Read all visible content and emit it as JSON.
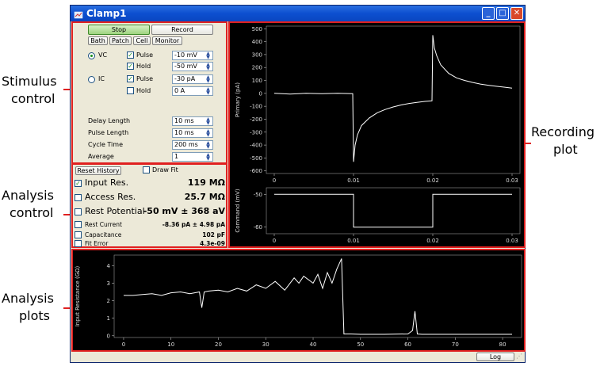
{
  "window": {
    "title": "Clamp1",
    "minimize": "_",
    "maximize": "□",
    "close": "✕"
  },
  "callouts": {
    "stimulus": [
      "Stimulus",
      "control"
    ],
    "analysis_control": [
      "Analysis",
      "control"
    ],
    "analysis_plots": [
      "Analysis",
      "plots"
    ],
    "recording": [
      "Recording",
      "plot"
    ]
  },
  "stimulus": {
    "stop_label": "Stop",
    "record_label": "Record",
    "mode_buttons": [
      "Bath",
      "Patch",
      "Cell",
      "Monitor"
    ],
    "vc_label": "VC",
    "ic_label": "IC",
    "vc_pulse_label": "Pulse",
    "vc_pulse_value": "-10 mV",
    "vc_hold_label": "Hold",
    "vc_hold_value": "-50 mV",
    "ic_pulse_label": "Pulse",
    "ic_pulse_value": "-30 pA",
    "ic_hold_label": "Hold",
    "ic_hold_value": "0 A",
    "timing": [
      {
        "label": "Delay Length",
        "value": "10 ms"
      },
      {
        "label": "Pulse Length",
        "value": "10 ms"
      },
      {
        "label": "Cycle Time",
        "value": "200 ms"
      },
      {
        "label": "Average",
        "value": "1"
      }
    ]
  },
  "analysis": {
    "reset_label": "Reset History",
    "draw_fit_label": "Draw Fit",
    "rows": [
      {
        "label": "Input Res.",
        "value": "119 MΩ",
        "checked": true
      },
      {
        "label": "Access Res.",
        "value": "25.7 MΩ",
        "checked": false
      },
      {
        "label": "Rest Potential",
        "value": "-50 mV ± 368 aV",
        "checked": false
      },
      {
        "label": "Rest Current",
        "value": "-8.36 pA ± 4.98 pA",
        "checked": false
      },
      {
        "label": "Capacitance",
        "value": "102 pF",
        "checked": false
      },
      {
        "label": "Fit Error",
        "value": "4.3e-09",
        "checked": false
      }
    ]
  },
  "status": {
    "log_label": "Log"
  },
  "chart_data": [
    {
      "type": "line",
      "name": "recording-primary",
      "ylabel": "Primary (pA)",
      "xlim": [
        -0.001,
        0.031
      ],
      "ylim": [
        -620,
        520
      ],
      "yticks": [
        500,
        400,
        300,
        200,
        100,
        0,
        -100,
        -200,
        -300,
        -400,
        -500,
        -600
      ],
      "xticks": [
        0,
        0.01,
        0.02,
        0.03
      ],
      "xtick_labels": [
        "0",
        "0.01",
        "0.02",
        "0.03"
      ],
      "line_color": "#ffffff",
      "x": [
        0,
        0.002,
        0.004,
        0.006,
        0.008,
        0.0099,
        0.01,
        0.0102,
        0.0105,
        0.011,
        0.012,
        0.013,
        0.014,
        0.015,
        0.016,
        0.017,
        0.018,
        0.019,
        0.0199,
        0.02,
        0.0202,
        0.0205,
        0.021,
        0.022,
        0.023,
        0.024,
        0.025,
        0.026,
        0.027,
        0.028,
        0.029,
        0.03
      ],
      "y": [
        0,
        -5,
        0,
        -3,
        0,
        -2,
        -530,
        -400,
        -320,
        -250,
        -190,
        -150,
        -125,
        -105,
        -90,
        -78,
        -70,
        -62,
        -58,
        450,
        350,
        290,
        220,
        155,
        120,
        100,
        85,
        72,
        63,
        55,
        48,
        40
      ]
    },
    {
      "type": "line",
      "name": "recording-command",
      "ylabel": "Command (mV)",
      "xlim": [
        -0.001,
        0.031
      ],
      "ylim": [
        -62,
        -48
      ],
      "yticks": [
        -50,
        -60
      ],
      "xticks": [
        0,
        0.01,
        0.02,
        0.03
      ],
      "xtick_labels": [
        "0",
        "0.01",
        "0.02",
        "0.03"
      ],
      "line_color": "#ffffff",
      "x": [
        0,
        0.01,
        0.01,
        0.02,
        0.02,
        0.03
      ],
      "y": [
        -50,
        -50,
        -60,
        -60,
        -50,
        -50
      ]
    },
    {
      "type": "line",
      "name": "analysis-input-resistance",
      "ylabel": "Input Resistance (GΩ)",
      "xlim": [
        -2,
        84
      ],
      "ylim": [
        -0.1,
        4.6
      ],
      "yticks": [
        0,
        1,
        2,
        3,
        4
      ],
      "xticks": [
        0,
        10,
        20,
        30,
        40,
        50,
        60,
        70,
        80
      ],
      "xtick_labels": [
        "0",
        "10",
        "20",
        "30",
        "40",
        "50",
        "60",
        "70",
        "80"
      ],
      "line_color": "#ffffff",
      "x": [
        0,
        2,
        4,
        6,
        8,
        10,
        12,
        14,
        16,
        16.5,
        17,
        18,
        20,
        22,
        24,
        26,
        28,
        30,
        32,
        34,
        36,
        37,
        38,
        40,
        41,
        42,
        43,
        44,
        45,
        46,
        46.5,
        47,
        48,
        50,
        55,
        60,
        61,
        61.5,
        62,
        63,
        70,
        80,
        82
      ],
      "y": [
        2.3,
        2.3,
        2.35,
        2.4,
        2.3,
        2.45,
        2.5,
        2.4,
        2.5,
        1.6,
        2.5,
        2.55,
        2.6,
        2.5,
        2.7,
        2.55,
        2.9,
        2.7,
        3.1,
        2.6,
        3.3,
        3.0,
        3.4,
        3.0,
        3.5,
        2.7,
        3.6,
        3.0,
        3.8,
        4.4,
        0.1,
        0.1,
        0.1,
        0.08,
        0.08,
        0.1,
        0.3,
        1.4,
        0.1,
        0.08,
        0.08,
        0.08,
        0.08
      ]
    }
  ]
}
